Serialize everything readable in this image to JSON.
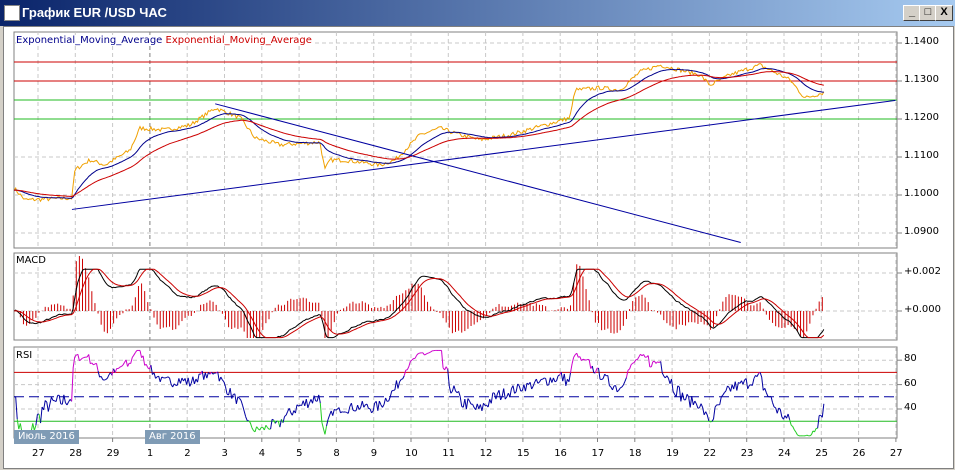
{
  "window": {
    "title": "График EUR /USD  ЧАС",
    "minimize": "_",
    "maximize": "□",
    "close": "X"
  },
  "legend": {
    "ema_fast": "Exponential_Moving_Average",
    "ema_slow": "Exponential_Moving_Average"
  },
  "colors": {
    "price": "#f0a000",
    "ema_fast": "#00008b",
    "ema_slow": "#cc0000",
    "trend": "#0000a0",
    "resistance": "#cc0000",
    "support": "#22bb22",
    "macd_line": "#000000",
    "rsi": "#0000a0",
    "rsi_over": "#cc00cc",
    "rsi_under": "#22cc22"
  },
  "panels": {
    "macd": "MACD",
    "rsi": "RSI"
  },
  "months": [
    "Июль 2016",
    "Авг 2016"
  ],
  "chart_data": [
    {
      "type": "line",
      "title": "EUR/USD H1",
      "x_unit": "days from 27 Jul 2016 label",
      "price_anchors": [
        [
          -0.64,
          1.1018
        ],
        [
          -0.35,
          1.0987
        ],
        [
          0.91,
          1.0992
        ],
        [
          0.99,
          1.1066
        ],
        [
          1.39,
          1.1092
        ],
        [
          1.8,
          1.1079
        ],
        [
          2.47,
          1.1118
        ],
        [
          2.73,
          1.1176
        ],
        [
          3.4,
          1.1171
        ],
        [
          4.08,
          1.1184
        ],
        [
          4.75,
          1.1229
        ],
        [
          5.42,
          1.1203
        ],
        [
          5.82,
          1.115
        ],
        [
          6.49,
          1.1132
        ],
        [
          7.56,
          1.1139
        ],
        [
          7.69,
          1.1066
        ],
        [
          7.83,
          1.1092
        ],
        [
          8.23,
          1.1092
        ],
        [
          9.17,
          1.1079
        ],
        [
          9.57,
          1.1092
        ],
        [
          10.24,
          1.1158
        ],
        [
          10.78,
          1.1176
        ],
        [
          11.31,
          1.1158
        ],
        [
          11.85,
          1.1145
        ],
        [
          12.65,
          1.1158
        ],
        [
          13.59,
          1.1184
        ],
        [
          14.26,
          1.1203
        ],
        [
          14.4,
          1.1276
        ],
        [
          15.07,
          1.1282
        ],
        [
          15.6,
          1.1276
        ],
        [
          16.14,
          1.1324
        ],
        [
          16.68,
          1.1342
        ],
        [
          17.21,
          1.1329
        ],
        [
          17.75,
          1.1316
        ],
        [
          18.02,
          1.1289
        ],
        [
          18.55,
          1.1316
        ],
        [
          19.36,
          1.1342
        ],
        [
          20.16,
          1.1303
        ],
        [
          20.56,
          1.1255
        ],
        [
          21.1,
          1.1271
        ]
      ],
      "ema_periods": [
        20,
        50
      ],
      "y_ticks": [
        "1.1400",
        "1.1300",
        "1.1200",
        "1.1100",
        "1.1000",
        "1.0900"
      ],
      "y_tick_values": [
        1.14,
        1.13,
        1.12,
        1.11,
        1.1,
        1.09
      ],
      "ylim": [
        1.0875,
        1.143
      ],
      "horizontal_levels": {
        "resistance": [
          1.135,
          1.13
        ],
        "support": [
          1.125,
          1.12
        ]
      },
      "trendlines": [
        [
          [
            0.91,
            1.0962
          ],
          [
            22.99,
            1.1249
          ]
        ],
        [
          [
            4.75,
            1.124
          ],
          [
            18.84,
            1.0875
          ]
        ]
      ],
      "x_ticks": [
        "27",
        "28",
        "29",
        "1",
        "2",
        "3",
        "4",
        "5",
        "8",
        "9",
        "10",
        "11",
        "12",
        "15",
        "16",
        "17",
        "18",
        "19",
        "22",
        "23",
        "24",
        "25",
        "26",
        "27"
      ]
    },
    {
      "type": "line",
      "title": "MACD",
      "y_ticks": [
        "+0.002",
        "+0.000"
      ],
      "y_tick_values": [
        0.002,
        0
      ],
      "params": [
        12,
        26,
        9
      ]
    },
    {
      "type": "line",
      "title": "RSI",
      "y_ticks": [
        "80",
        "60",
        "40"
      ],
      "y_tick_values": [
        80,
        60,
        40
      ],
      "levels": [
        70,
        50,
        30
      ],
      "period": 14
    }
  ]
}
